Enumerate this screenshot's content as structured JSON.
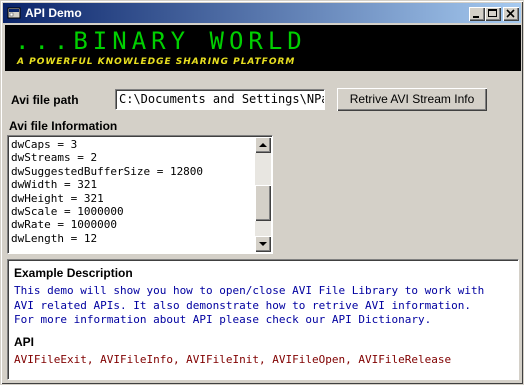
{
  "window": {
    "title": "API Demo"
  },
  "banner": {
    "title": "...BINARY WORLD",
    "subtitle": "A POWERFUL KNOWLEDGE SHARING PLATFORM"
  },
  "path_section": {
    "label": "Avi file path",
    "value": "C:\\Documents and Settings\\NPa",
    "button_label": "Retrive AVI Stream Info"
  },
  "info_section": {
    "label": "Avi file Information",
    "lines": [
      "dwCaps = 3",
      "dwStreams = 2",
      "dwSuggestedBufferSize = 12800",
      "dwWidth = 321",
      "dwHeight = 321",
      "dwScale = 1000000",
      "dwRate = 1000000",
      "dwLength = 12"
    ]
  },
  "description": {
    "heading": "Example Description",
    "text_lines": [
      "This demo will show you how to open/close AVI File Library to work with",
      "AVI related APIs. It also demonstrate how to retrive AVI information.",
      "For more information about API please check our API Dictionary."
    ],
    "api_heading": "API",
    "api_list": "AVIFileExit, AVIFileInfo, AVIFileInit, AVIFileOpen, AVIFileRelease"
  }
}
